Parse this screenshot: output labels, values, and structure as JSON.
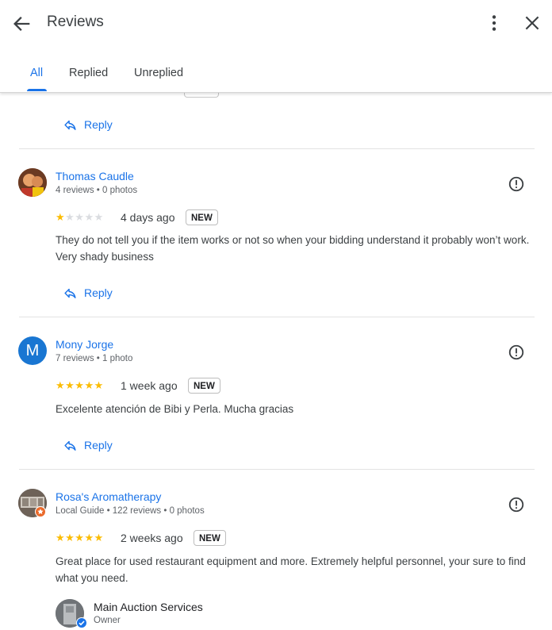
{
  "header": {
    "title": "Reviews"
  },
  "tabs": [
    {
      "label": "All"
    },
    {
      "label": "Replied"
    },
    {
      "label": "Unreplied"
    }
  ],
  "reply_label": "Reply",
  "reviews": [
    {
      "name": "Thomas Caudle",
      "meta": "4 reviews • 0 photos",
      "rating": 1,
      "date": "4 days ago",
      "badge": "NEW",
      "text": "They do not tell you if the item works or not so when your bidding understand it probably won’t work. Very shady business"
    },
    {
      "name": "Mony Jorge",
      "avatar_letter": "M",
      "avatar_color": "#1976d2",
      "meta": "7 reviews • 1 photo",
      "rating": 5,
      "date": "1 week ago",
      "badge": "NEW",
      "text": "Excelente atención de Bibi y Perla. Mucha gracias"
    },
    {
      "name": "Rosa's Aromatherapy",
      "meta": "Local Guide • 122 reviews • 0 photos",
      "rating": 5,
      "date": "2 weeks ago",
      "badge": "NEW",
      "text": "Great place for used restaurant equipment and more. Extremely helpful personnel, your sure to find what you need."
    }
  ],
  "owner_reply": {
    "name": "Main Auction Services",
    "role": "Owner"
  },
  "colors": {
    "accent": "#1a73e8",
    "star": "#fbbc04",
    "star_empty": "#dadce0"
  }
}
